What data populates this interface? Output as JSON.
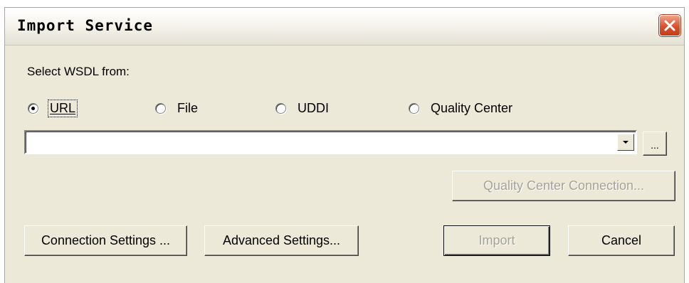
{
  "window": {
    "title": "Import Service",
    "close_icon": "close-icon"
  },
  "wsdl_source": {
    "label": "Select WSDL from:",
    "options": [
      {
        "label": "URL",
        "selected": true
      },
      {
        "label": "File",
        "selected": false
      },
      {
        "label": "UDDI",
        "selected": false
      },
      {
        "label": "Quality Center",
        "selected": false
      }
    ]
  },
  "url_combo": {
    "value": "",
    "browse_label": "..."
  },
  "buttons": {
    "qc_connection": "Quality Center Connection...",
    "connection_settings": "Connection Settings ...",
    "advanced_settings": "Advanced Settings...",
    "import": "Import",
    "cancel": "Cancel"
  },
  "colors": {
    "dialog_bg": "#ece9d8",
    "close_button": "#d9512c",
    "disabled_text": "#a5a298"
  }
}
